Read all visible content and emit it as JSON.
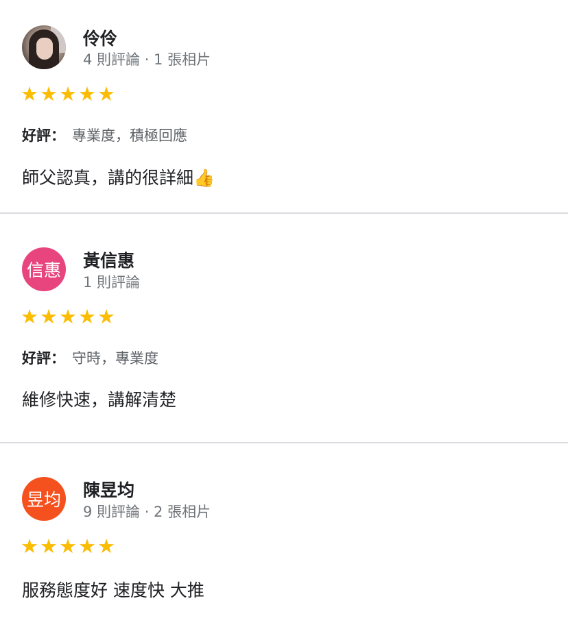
{
  "colors": {
    "star": "#fbbc04",
    "divider": "#dadce0",
    "avatar_pink": "#e8457f",
    "avatar_orange": "#f4511e",
    "meta_text": "#70757a"
  },
  "reviews": [
    {
      "name": "伶伶",
      "avatar_type": "photo",
      "meta": "4 則評論 · 1 張相片",
      "rating": 5,
      "attributes": {
        "label": "好評",
        "separator": "：",
        "value": "專業度，積極回應"
      },
      "text": "師父認真，講的很詳細👍"
    },
    {
      "name": "黃信惠",
      "avatar_text": "信惠",
      "meta": "1 則評論",
      "rating": 5,
      "attributes": {
        "label": "好評",
        "separator": "：",
        "value": "守時，專業度"
      },
      "text": "維修快速，講解清楚"
    },
    {
      "name": "陳昱均",
      "avatar_text": "昱均",
      "meta": "9 則評論 · 2 張相片",
      "rating": 5,
      "text": "服務態度好 速度快 大推"
    }
  ],
  "icons": {
    "star": "star-icon"
  }
}
